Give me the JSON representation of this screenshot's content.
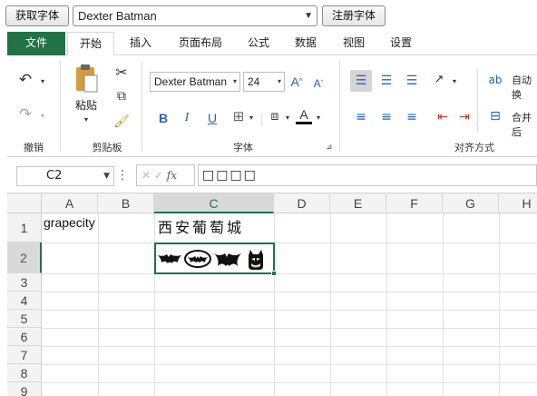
{
  "topbar": {
    "get_font_label": "获取字体",
    "font_name": "Dexter Batman",
    "register_font_label": "注册字体"
  },
  "tabs": [
    "文件",
    "开始",
    "插入",
    "页面布局",
    "公式",
    "数据",
    "视图",
    "设置"
  ],
  "ribbon": {
    "undo_group": "撤销",
    "clipboard_group": "剪贴板",
    "paste_label": "粘贴",
    "font_group": "字体",
    "font_name": "Dexter Batman",
    "font_size": "24",
    "bold": "B",
    "italic": "I",
    "underline": "U",
    "align_group": "对齐方式",
    "wrap_label": "自动换",
    "merge_label": "合并后"
  },
  "formula_bar": {
    "cell_ref": "C2",
    "fx": "fx",
    "value": "□□□□"
  },
  "grid": {
    "columns": [
      "A",
      "B",
      "C",
      "D",
      "E",
      "F",
      "G",
      "H"
    ],
    "rows": [
      "1",
      "2",
      "3",
      "4",
      "5",
      "6",
      "7",
      "8",
      "9"
    ],
    "cells": {
      "A1": "grapecity",
      "C1": "西安葡萄城"
    }
  },
  "colors": {
    "accent": "#217346",
    "align_highlight": "#d4d4d4"
  }
}
